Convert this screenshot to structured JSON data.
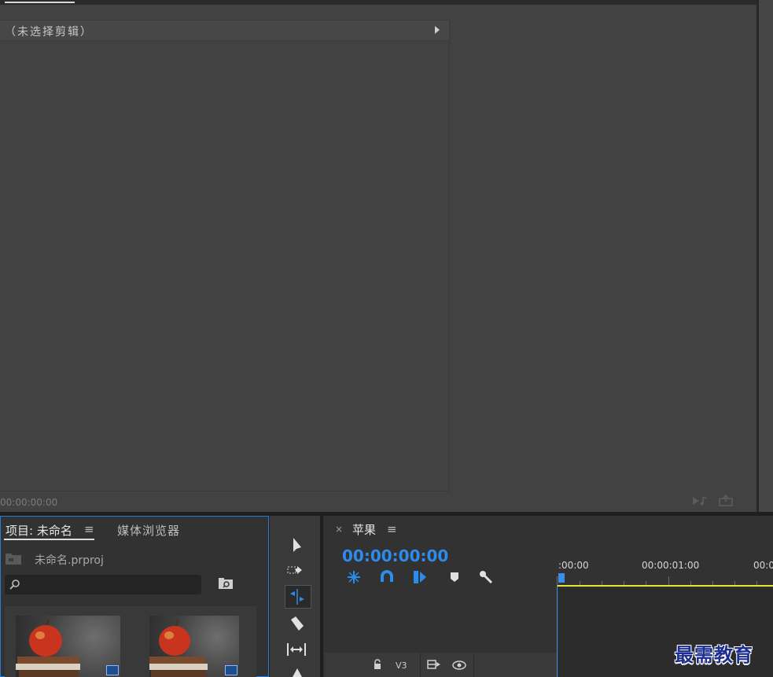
{
  "source_panel": {
    "no_clip_label": "（未选择剪辑）",
    "timecode": "00:00:00:00"
  },
  "project_panel": {
    "tab_project": "项目: 未命名",
    "tab_menu": "≡",
    "tab_media_browser": "媒体浏览器",
    "project_file": "未命名.prproj",
    "search": {
      "placeholder": "",
      "value": ""
    },
    "items": [
      {
        "icon": "sequence-badge-icon"
      },
      {
        "icon": "clip-badge-icon"
      }
    ]
  },
  "tools": [
    "selection-tool-icon",
    "track-select-forward-icon",
    "ripple-edit-tool-icon",
    "razor-tool-icon",
    "slip-tool-icon",
    "pen-tool-icon"
  ],
  "timeline": {
    "close": "×",
    "sequence_name": "苹果",
    "menu": "≡",
    "timecode": "00:00:00:00",
    "ruler_labels": [
      ":00:00",
      "00:00:01:00",
      "00:0"
    ],
    "tracks": [
      {
        "label": "V3"
      }
    ]
  },
  "watermark": "最需教育",
  "colors": {
    "accent_blue": "#2d8ceb",
    "in_out_yellow": "#e9e23a",
    "panel_bg": "#424242",
    "focus_border": "#2a7bd5"
  }
}
